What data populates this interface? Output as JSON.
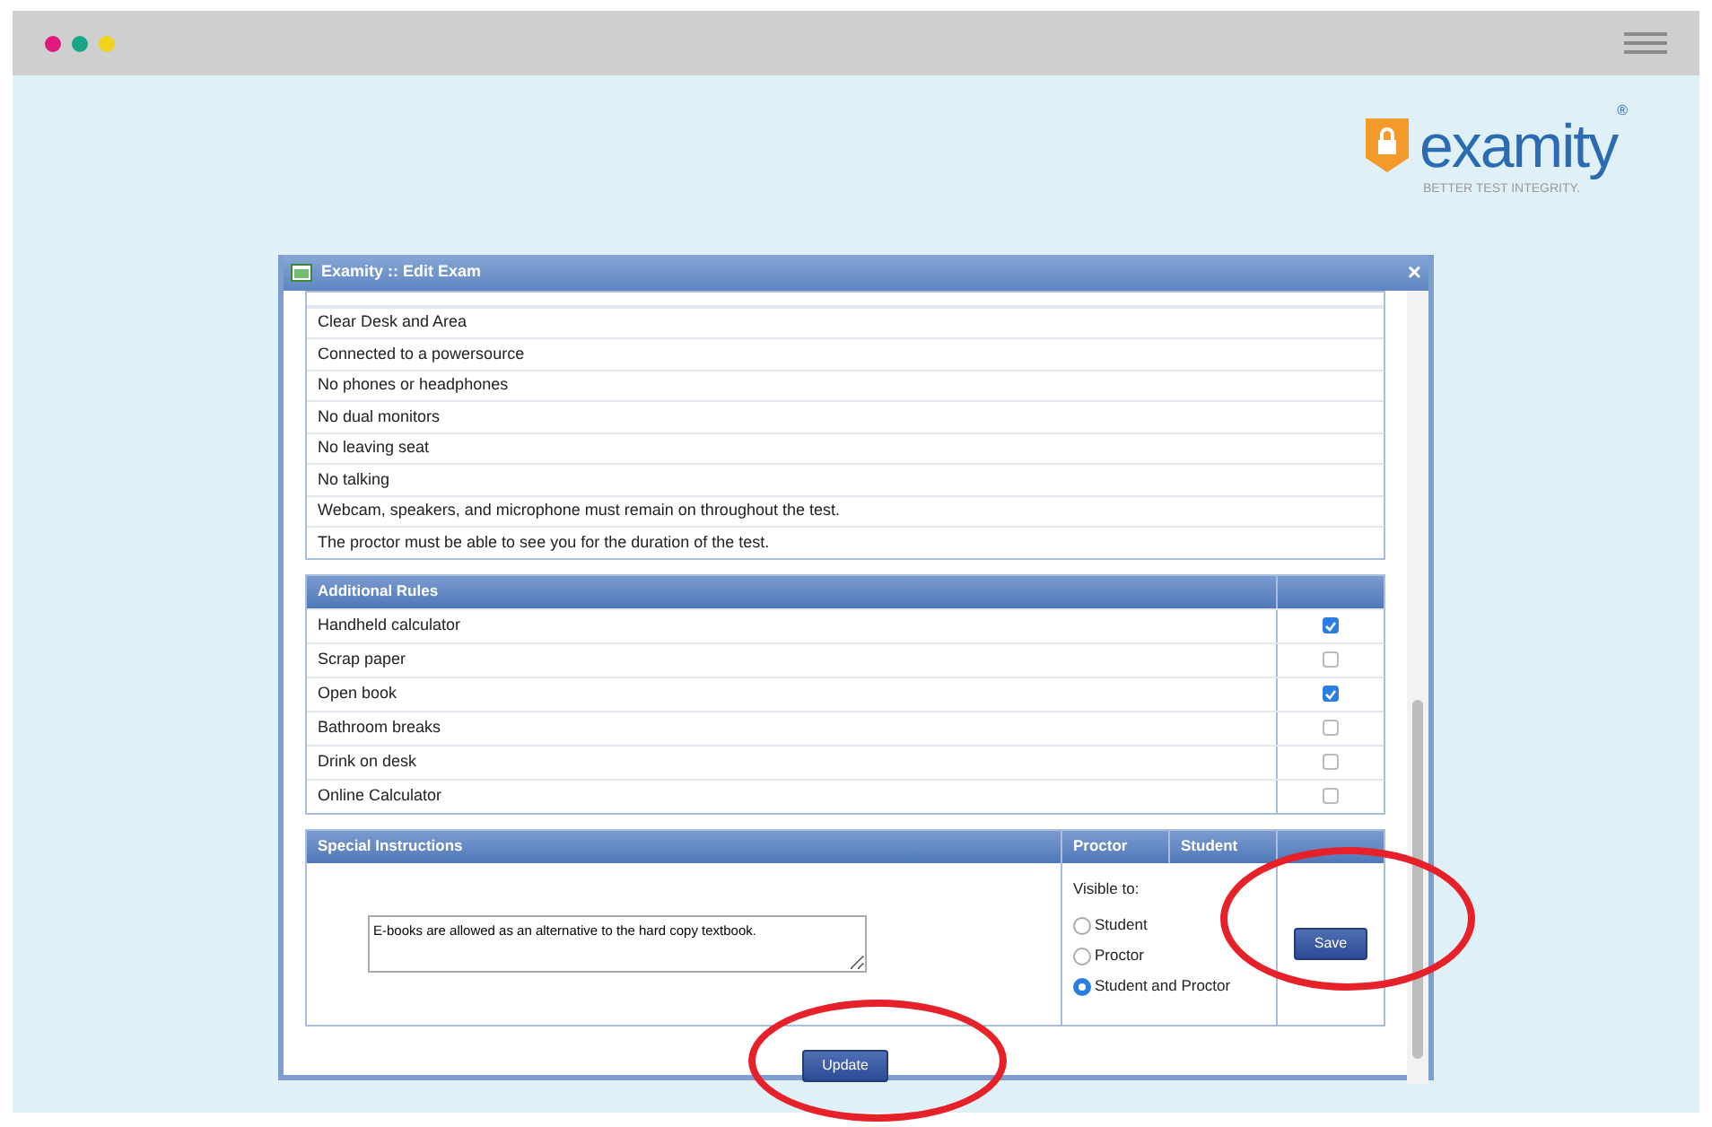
{
  "browser": {
    "dots": [
      {
        "color": "#e0197d"
      },
      {
        "color": "#1aa589"
      },
      {
        "color": "#f2d31b"
      }
    ]
  },
  "logo": {
    "wordmark": "examity",
    "registered": "®",
    "tagline": "BETTER TEST INTEGRITY."
  },
  "dialog": {
    "title": "Examity :: Edit Exam",
    "close": "×",
    "rules": [
      "Clear Desk and Area",
      "Connected to a powersource",
      "No phones or headphones",
      "No dual monitors",
      "No leaving seat",
      "No talking",
      "Webcam, speakers, and microphone must remain on throughout the test.",
      "The proctor must be able to see you for the duration of the test."
    ],
    "additional_rules": {
      "heading": "Additional Rules",
      "items": [
        {
          "label": "Handheld calculator",
          "checked": true
        },
        {
          "label": "Scrap paper",
          "checked": false
        },
        {
          "label": "Open book",
          "checked": true
        },
        {
          "label": "Bathroom breaks",
          "checked": false
        },
        {
          "label": "Drink on desk",
          "checked": false
        },
        {
          "label": "Online Calculator",
          "checked": false
        }
      ]
    },
    "special": {
      "columns": [
        "Special Instructions",
        "Proctor",
        "Student"
      ],
      "text": "E-books are allowed as an alternative to the hard copy textbook.",
      "visible_label": "Visible to:",
      "options": [
        {
          "label": "Student",
          "selected": false
        },
        {
          "label": "Proctor",
          "selected": false
        },
        {
          "label": "Student and Proctor",
          "selected": true
        }
      ],
      "save": "Save"
    },
    "update": "Update"
  }
}
